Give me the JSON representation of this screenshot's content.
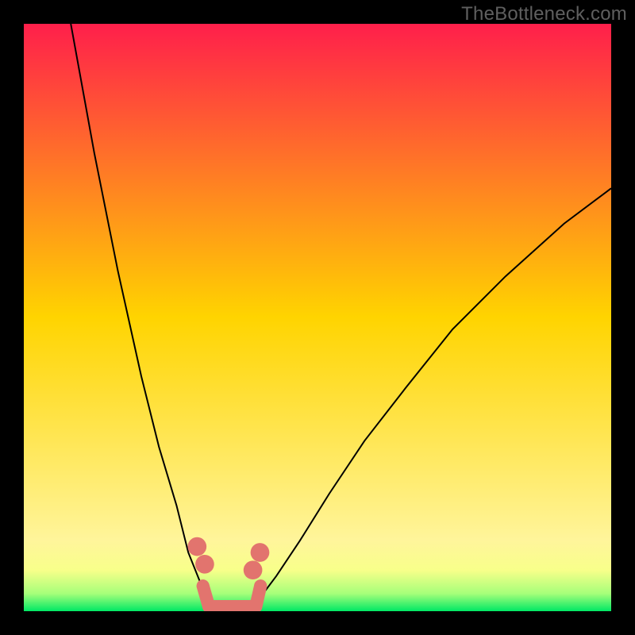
{
  "watermark": "TheBottleneck.com",
  "chart_data": {
    "type": "line",
    "title": "",
    "xlabel": "",
    "ylabel": "",
    "xlim": [
      0,
      100
    ],
    "ylim": [
      0,
      100
    ],
    "grid": false,
    "legend": false,
    "background_gradient": {
      "stops": [
        {
          "pos": 0.0,
          "color": "#ff1f4b"
        },
        {
          "pos": 0.5,
          "color": "#ffd400"
        },
        {
          "pos": 0.88,
          "color": "#fff59b"
        },
        {
          "pos": 0.93,
          "color": "#f8ff8a"
        },
        {
          "pos": 0.97,
          "color": "#a6ff7a"
        },
        {
          "pos": 1.0,
          "color": "#00e865"
        }
      ]
    },
    "series": [
      {
        "name": "left-branch",
        "x": [
          8,
          12,
          16,
          20,
          23,
          26,
          28,
          30,
          32,
          33,
          34
        ],
        "y": [
          100,
          78,
          58,
          40,
          28,
          18,
          10,
          5,
          2,
          1,
          0
        ]
      },
      {
        "name": "right-branch",
        "x": [
          38,
          40,
          43,
          47,
          52,
          58,
          65,
          73,
          82,
          92,
          100
        ],
        "y": [
          0,
          2,
          6,
          12,
          20,
          29,
          38,
          48,
          57,
          66,
          72
        ]
      }
    ],
    "markers": [
      {
        "name": "left-dot-a",
        "x": 29.5,
        "y": 11,
        "r": 1.6,
        "color": "#e2746e"
      },
      {
        "name": "left-dot-b",
        "x": 30.8,
        "y": 8,
        "r": 1.6,
        "color": "#e2746e"
      },
      {
        "name": "right-dot-a",
        "x": 39.0,
        "y": 7,
        "r": 1.6,
        "color": "#e2746e"
      },
      {
        "name": "right-dot-b",
        "x": 40.2,
        "y": 10,
        "r": 1.6,
        "color": "#e2746e"
      }
    ],
    "bottom_band": {
      "name": "valley-band",
      "x0": 31.5,
      "x1": 39.5,
      "y": 0.8,
      "thickness": 2.2,
      "color": "#e2746e"
    },
    "valley_x": 36
  }
}
